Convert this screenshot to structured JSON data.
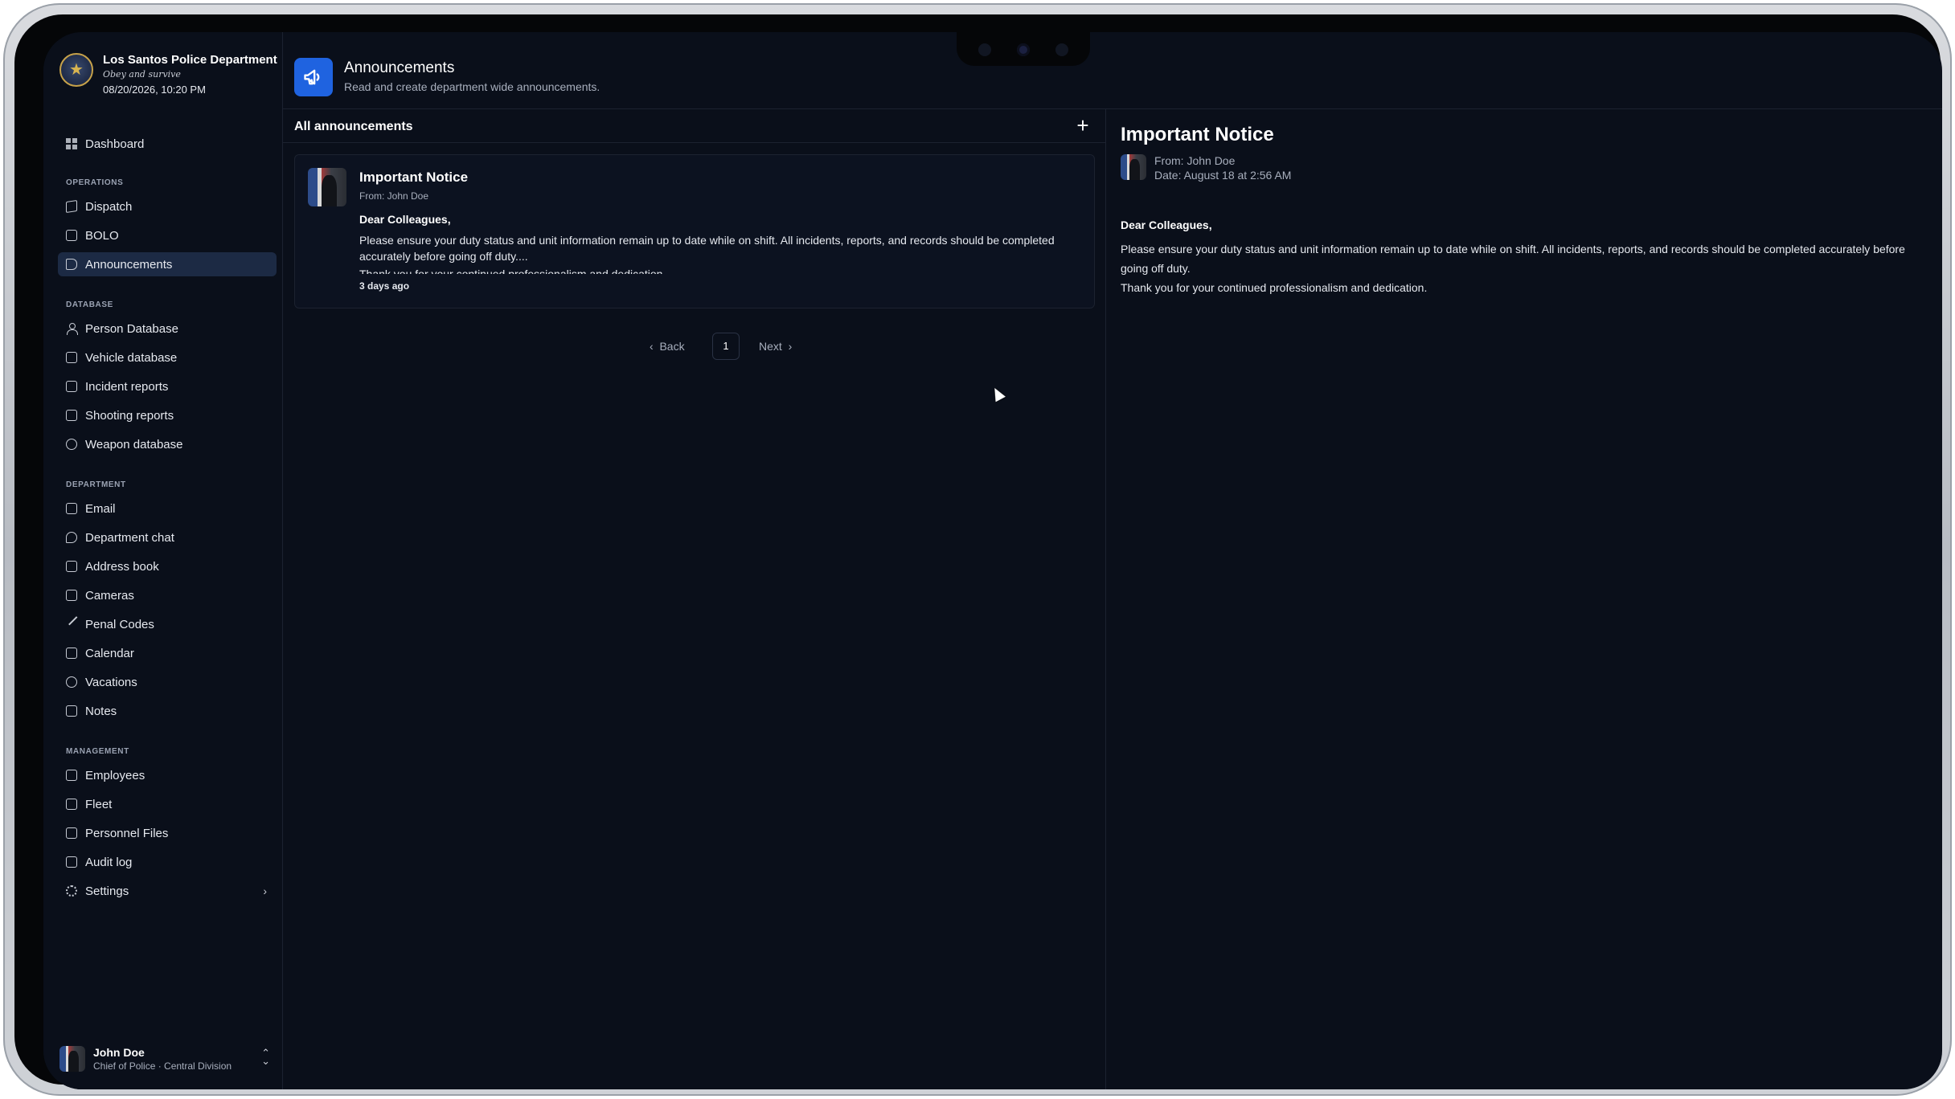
{
  "brand": {
    "name": "Los Santos Police Department",
    "motto": "Obey and survive",
    "datetime": "08/20/2026, 10:20 PM"
  },
  "sidebar": {
    "dashboard": "Dashboard",
    "sections": {
      "operations": "OPERATIONS",
      "database": "DATABASE",
      "department": "DEPARTMENT",
      "management": "MANAGEMENT"
    },
    "operations": [
      "Dispatch",
      "BOLO",
      "Announcements"
    ],
    "database": [
      "Person Database",
      "Vehicle database",
      "Incident reports",
      "Shooting reports",
      "Weapon database"
    ],
    "department": [
      "Email",
      "Department chat",
      "Address book",
      "Cameras",
      "Penal Codes",
      "Calendar",
      "Vacations",
      "Notes"
    ],
    "management": [
      "Employees",
      "Fleet",
      "Personnel Files",
      "Audit log",
      "Settings"
    ],
    "active": "Announcements",
    "icons": {
      "dashboard": "grid-icon",
      "dispatch": "map-icon",
      "bolo": "book-icon",
      "announcements": "megaphone-icon",
      "person": "user-icon",
      "vehicle": "car-icon",
      "incident": "file-icon",
      "shooting": "file-icon",
      "weapon": "target-icon",
      "email": "mail-icon",
      "chat": "chat-icon",
      "address": "book-icon",
      "cameras": "video-icon",
      "penal": "gavel-icon",
      "calendar": "calendar-icon",
      "vacations": "plane-icon",
      "notes": "note-icon",
      "employees": "id-icon",
      "fleet": "car-icon",
      "personnel": "file-icon",
      "audit": "log-icon",
      "settings": "gear-icon"
    }
  },
  "header": {
    "title": "Announcements",
    "subtitle": "Read and create department wide announcements."
  },
  "list": {
    "title": "All announcements",
    "items": [
      {
        "title": "Important Notice",
        "from": "From: John Doe",
        "greeting": "Dear Colleagues,",
        "body": "Please ensure your duty status and unit information remain up to date while on shift. All incidents, reports, and records should be completed accurately before going off duty....",
        "body2": "Thank you for your continued professionalism and dedication.",
        "time": "3 days ago"
      }
    ],
    "pager": {
      "back": "Back",
      "page": "1",
      "next": "Next"
    }
  },
  "detail": {
    "title": "Important Notice",
    "from": "From: John Doe",
    "date": "Date: August 18 at 2:56 AM",
    "greeting": "Dear Colleagues,",
    "body": "Please ensure your duty status and unit information remain up to date while on shift. All incidents, reports, and records should be completed accurately before going off duty.",
    "body2": "Thank you for your continued professionalism and dedication."
  },
  "user": {
    "name": "John Doe",
    "role": "Chief of Police · Central Division"
  },
  "colors": {
    "accent": "#1f63e0",
    "background": "#0a0f1a",
    "active_nav": "#1c2a44"
  }
}
